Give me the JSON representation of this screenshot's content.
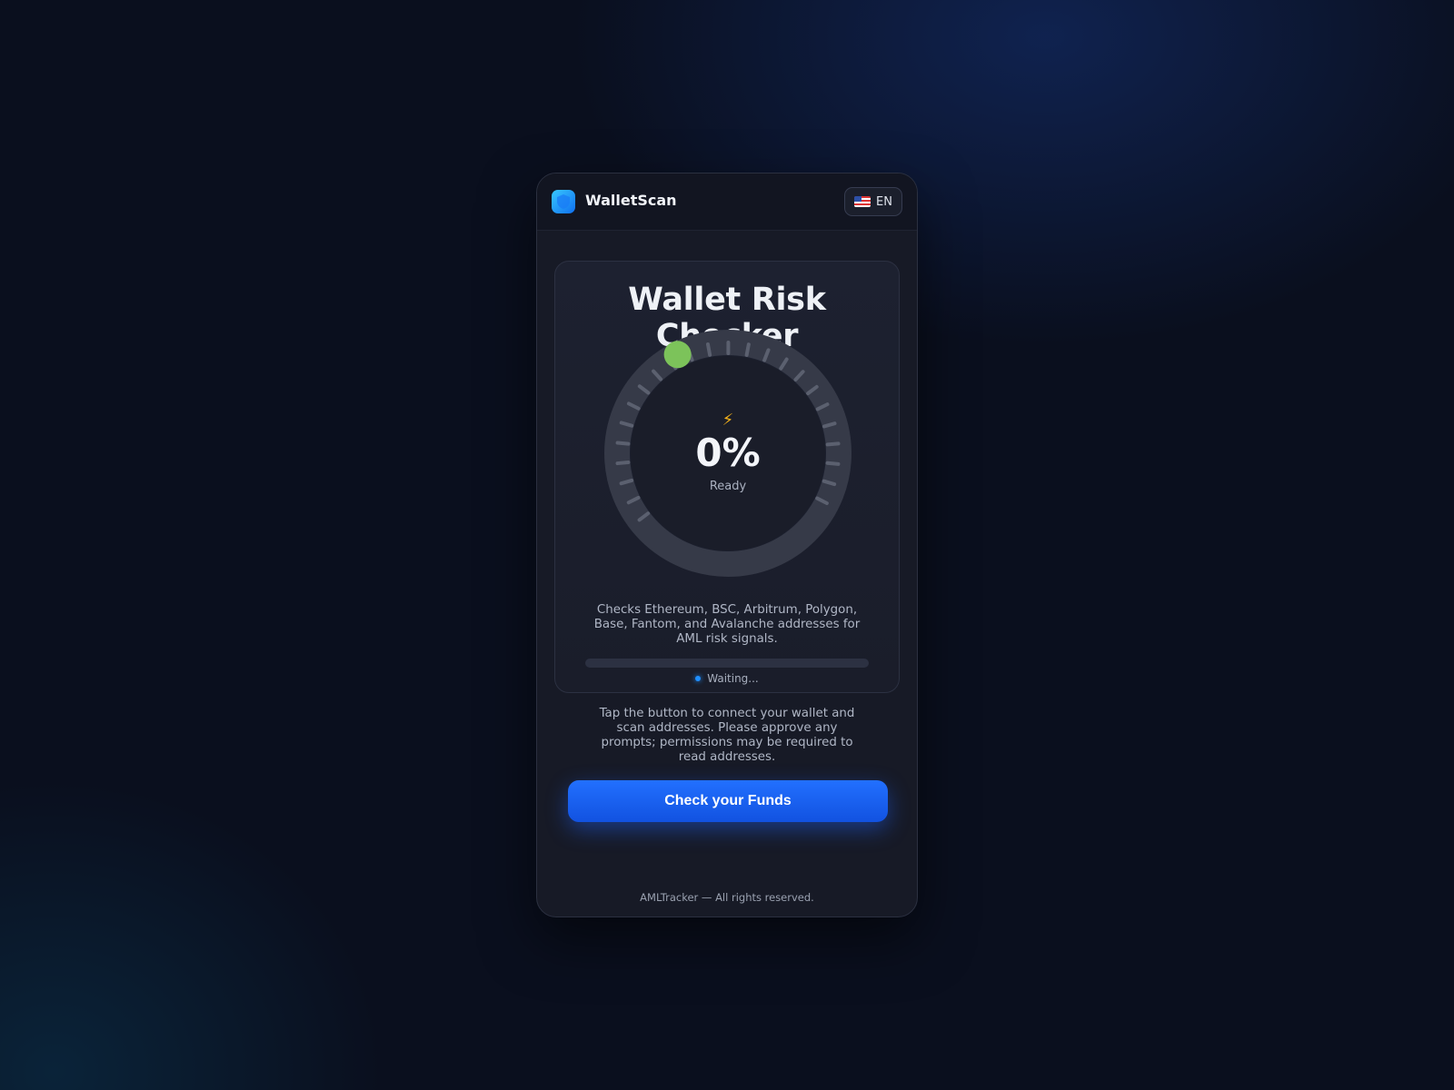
{
  "app": {
    "brand": "WalletScan",
    "language": {
      "label": "EN",
      "flag_icon": "us-flag-icon"
    },
    "logo_icon": "shield-icon"
  },
  "checker": {
    "title": "Wallet Risk Checker",
    "percent_label": "0%",
    "progress_fraction": 0,
    "state": "Ready",
    "bolt_icon": "lightning-icon",
    "description": "Checks Ethereum, BSC, Arbitrum, Polygon, Base, Fantom, and Avalanche addresses for AML risk signals.",
    "status": "Waiting..."
  },
  "hint": "Tap the button to connect your wallet and scan addresses. Please approve any prompts; permissions may be required to read addresses.",
  "cta_label": "Check your Funds",
  "footer": "AMLTracker — All rights reserved.",
  "colors": {
    "accent": "#1f66ff",
    "indicator": "#7cc35a",
    "bolt": "#f5b21a",
    "background": "#0a0f1e"
  }
}
